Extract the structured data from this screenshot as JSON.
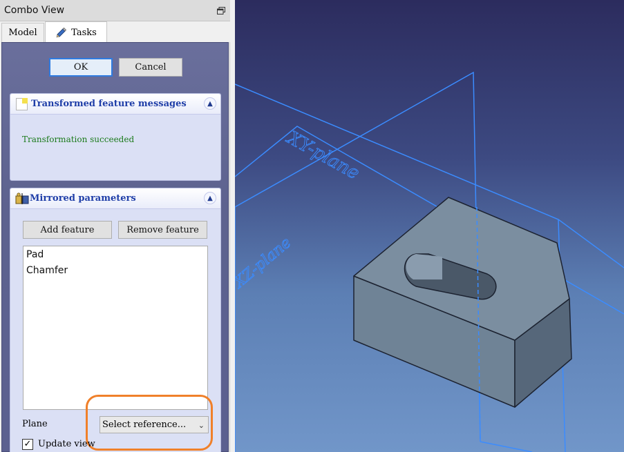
{
  "combo": {
    "title": "Combo View",
    "tabs": [
      {
        "label": "Model",
        "active": false
      },
      {
        "label": "Tasks",
        "active": true
      }
    ]
  },
  "task": {
    "ok_label": "OK",
    "cancel_label": "Cancel"
  },
  "messages": {
    "title": "Transformed feature messages",
    "text": "Transformation succeeded",
    "text_color": "#1b7a1b"
  },
  "mirrored": {
    "title": "Mirrored parameters",
    "add_label": "Add feature",
    "remove_label": "Remove feature",
    "features": [
      "Pad",
      "Chamfer"
    ],
    "plane_label": "Plane",
    "plane_value": "Select reference...",
    "update_label": "Update view",
    "update_checked": true
  },
  "viewport": {
    "plane_labels": [
      "XY-plane",
      "XZ-plane"
    ],
    "plane_color": "#3b8cff",
    "solid_color": "#6b7d8f"
  },
  "highlight_color": "#f0802a"
}
